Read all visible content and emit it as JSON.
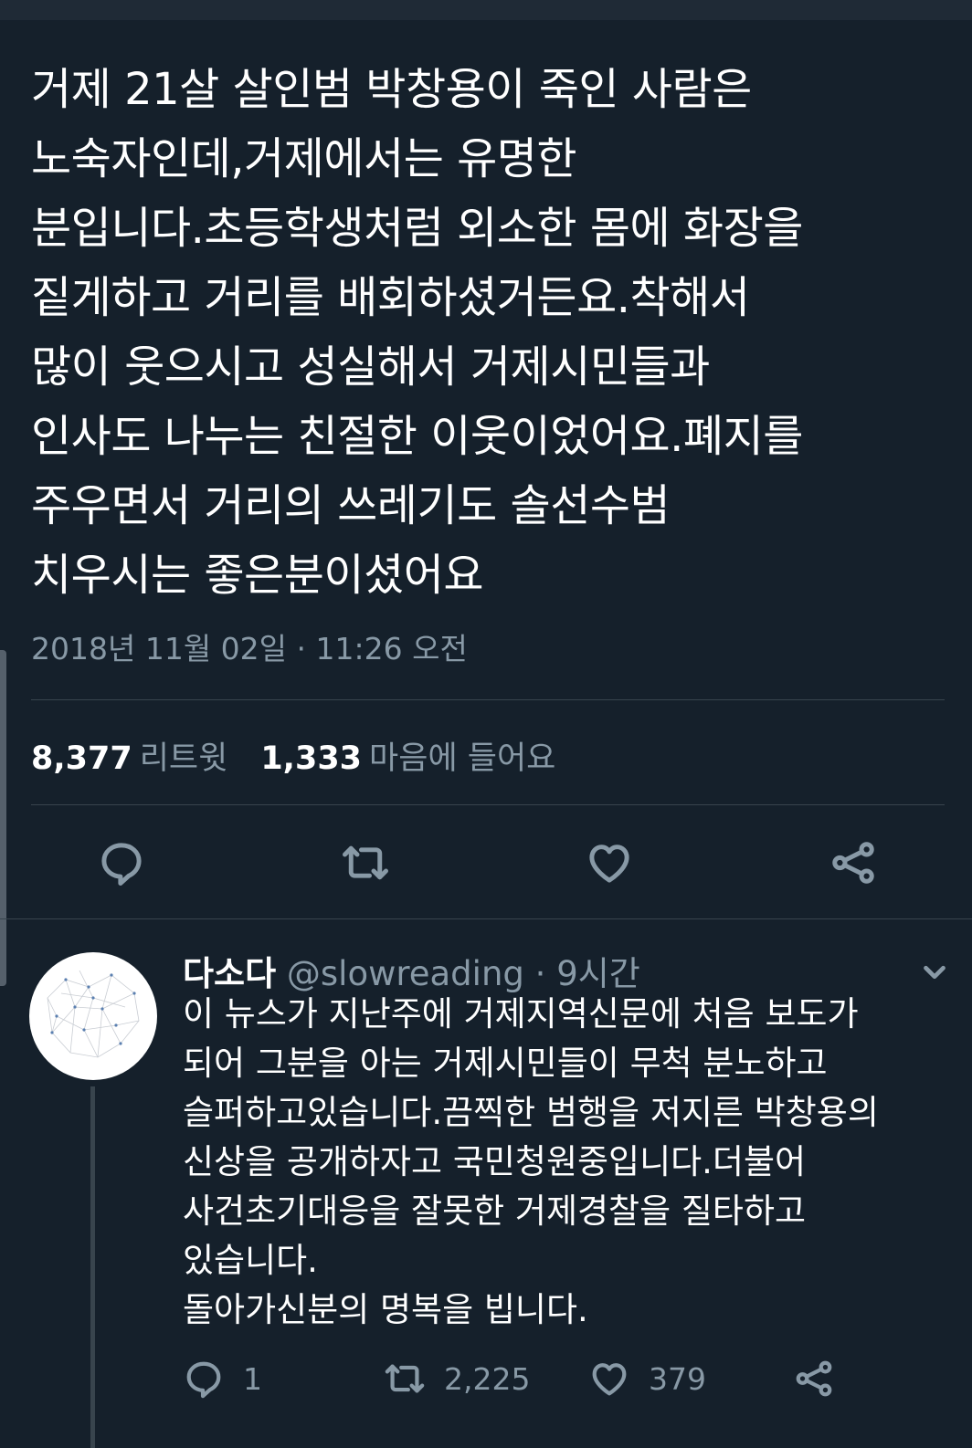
{
  "main_tweet": {
    "text": "거제 21살 살인범 박창용이 죽인 사람은\n노숙자인데,거제에서는 유명한\n분입니다.초등학생처럼 외소한 몸에 화장을\n짙게하고 거리를 배회하셨거든요.착해서\n많이 웃으시고 성실해서 거제시민들과\n인사도 나누는 친절한 이웃이었어요.폐지를\n주우면서 거리의 쓰레기도 솔선수범\n치우시는 좋은분이셨어요",
    "timestamp": "2018년 11월 02일 · 11:26 오전",
    "retweet_count": "8,377",
    "retweet_label": "리트윗",
    "like_count": "1,333",
    "like_label": "마음에 들어요",
    "actions": [
      "reply-icon",
      "retweet-icon",
      "heart-icon",
      "share-icon"
    ]
  },
  "reply": {
    "name": "다소다",
    "handle": "@slowreading",
    "separator": "·",
    "time": "9시간",
    "text": "이 뉴스가 지난주에 거제지역신문에 처음 보도가\n되어 그분을 아는 거제시민들이 무척 분노하고\n슬퍼하고있습니다.끔찍한 범행을 저지른 박창용의\n신상을 공개하자고 국민청원중입니다.더불어\n사건초기대응을 잘못한 거제경찰을 질타하고\n있습니다.\n돌아가신분의 명복을 빕니다.",
    "reply_count": "1",
    "retweet_count": "2,225",
    "like_count": "379"
  },
  "colors": {
    "background": "#15202b",
    "secondary_text": "#8899a6",
    "divider": "#38444d"
  }
}
